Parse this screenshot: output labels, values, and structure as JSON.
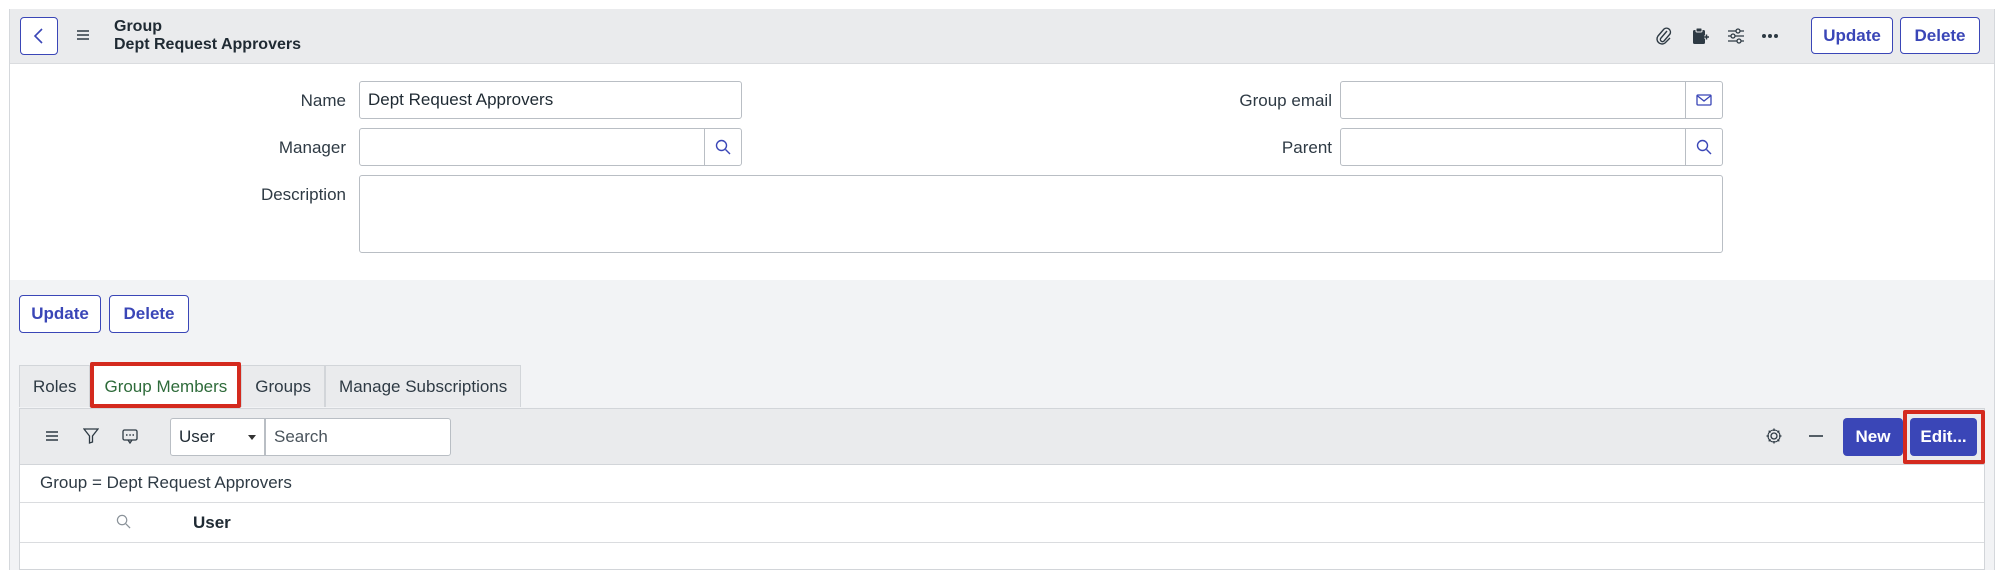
{
  "header": {
    "record_type": "Group",
    "record_name": "Dept Request Approvers",
    "update_label": "Update",
    "delete_label": "Delete"
  },
  "form": {
    "name_label": "Name",
    "name_value": "Dept Request Approvers",
    "manager_label": "Manager",
    "manager_value": "",
    "description_label": "Description",
    "description_value": "",
    "group_email_label": "Group email",
    "group_email_value": "",
    "parent_label": "Parent",
    "parent_value": ""
  },
  "actions": {
    "update_label": "Update",
    "delete_label": "Delete"
  },
  "tabs": [
    {
      "label": "Roles",
      "active": false
    },
    {
      "label": "Group Members",
      "active": true
    },
    {
      "label": "Groups",
      "active": false
    },
    {
      "label": "Manage Subscriptions",
      "active": false
    }
  ],
  "list": {
    "filter_field": "User",
    "search_placeholder": "Search",
    "new_label": "New",
    "edit_label": "Edit...",
    "breadcrumb": "Group = Dept Request Approvers",
    "column_user": "User"
  },
  "colors": {
    "accent": "#3a46b7",
    "highlight": "#d42a1e",
    "active_tab_text": "#2e6b3a"
  }
}
